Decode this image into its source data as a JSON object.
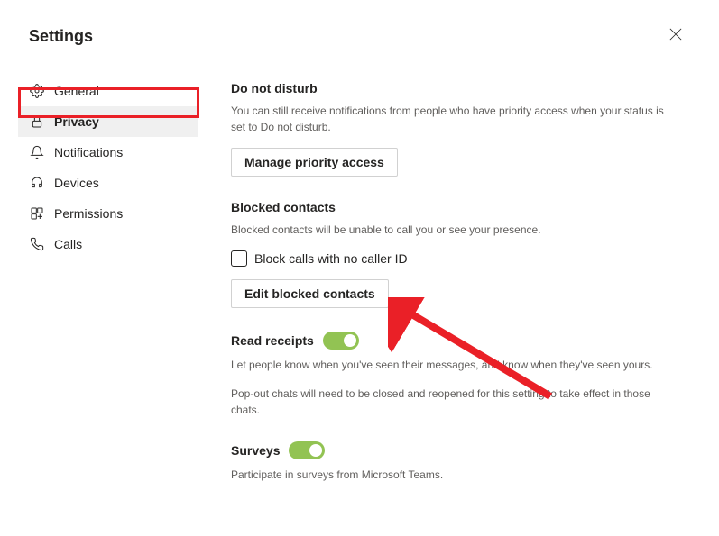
{
  "header": {
    "title": "Settings"
  },
  "sidebar": {
    "items": [
      {
        "label": "General"
      },
      {
        "label": "Privacy"
      },
      {
        "label": "Notifications"
      },
      {
        "label": "Devices"
      },
      {
        "label": "Permissions"
      },
      {
        "label": "Calls"
      }
    ]
  },
  "main": {
    "dnd": {
      "title": "Do not disturb",
      "desc": "You can still receive notifications from people who have priority access when your status is set to Do not disturb.",
      "button": "Manage priority access"
    },
    "blocked": {
      "title": "Blocked contacts",
      "desc": "Blocked contacts will be unable to call you or see your presence.",
      "checkbox_label": "Block calls with no caller ID",
      "button": "Edit blocked contacts"
    },
    "receipts": {
      "title": "Read receipts",
      "desc": "Let people know when you've seen their messages, and know when they've seen yours.",
      "desc2": "Pop-out chats will need to be closed and reopened for this setting to take effect in those chats."
    },
    "surveys": {
      "title": "Surveys",
      "desc": "Participate in surveys from Microsoft Teams."
    }
  }
}
